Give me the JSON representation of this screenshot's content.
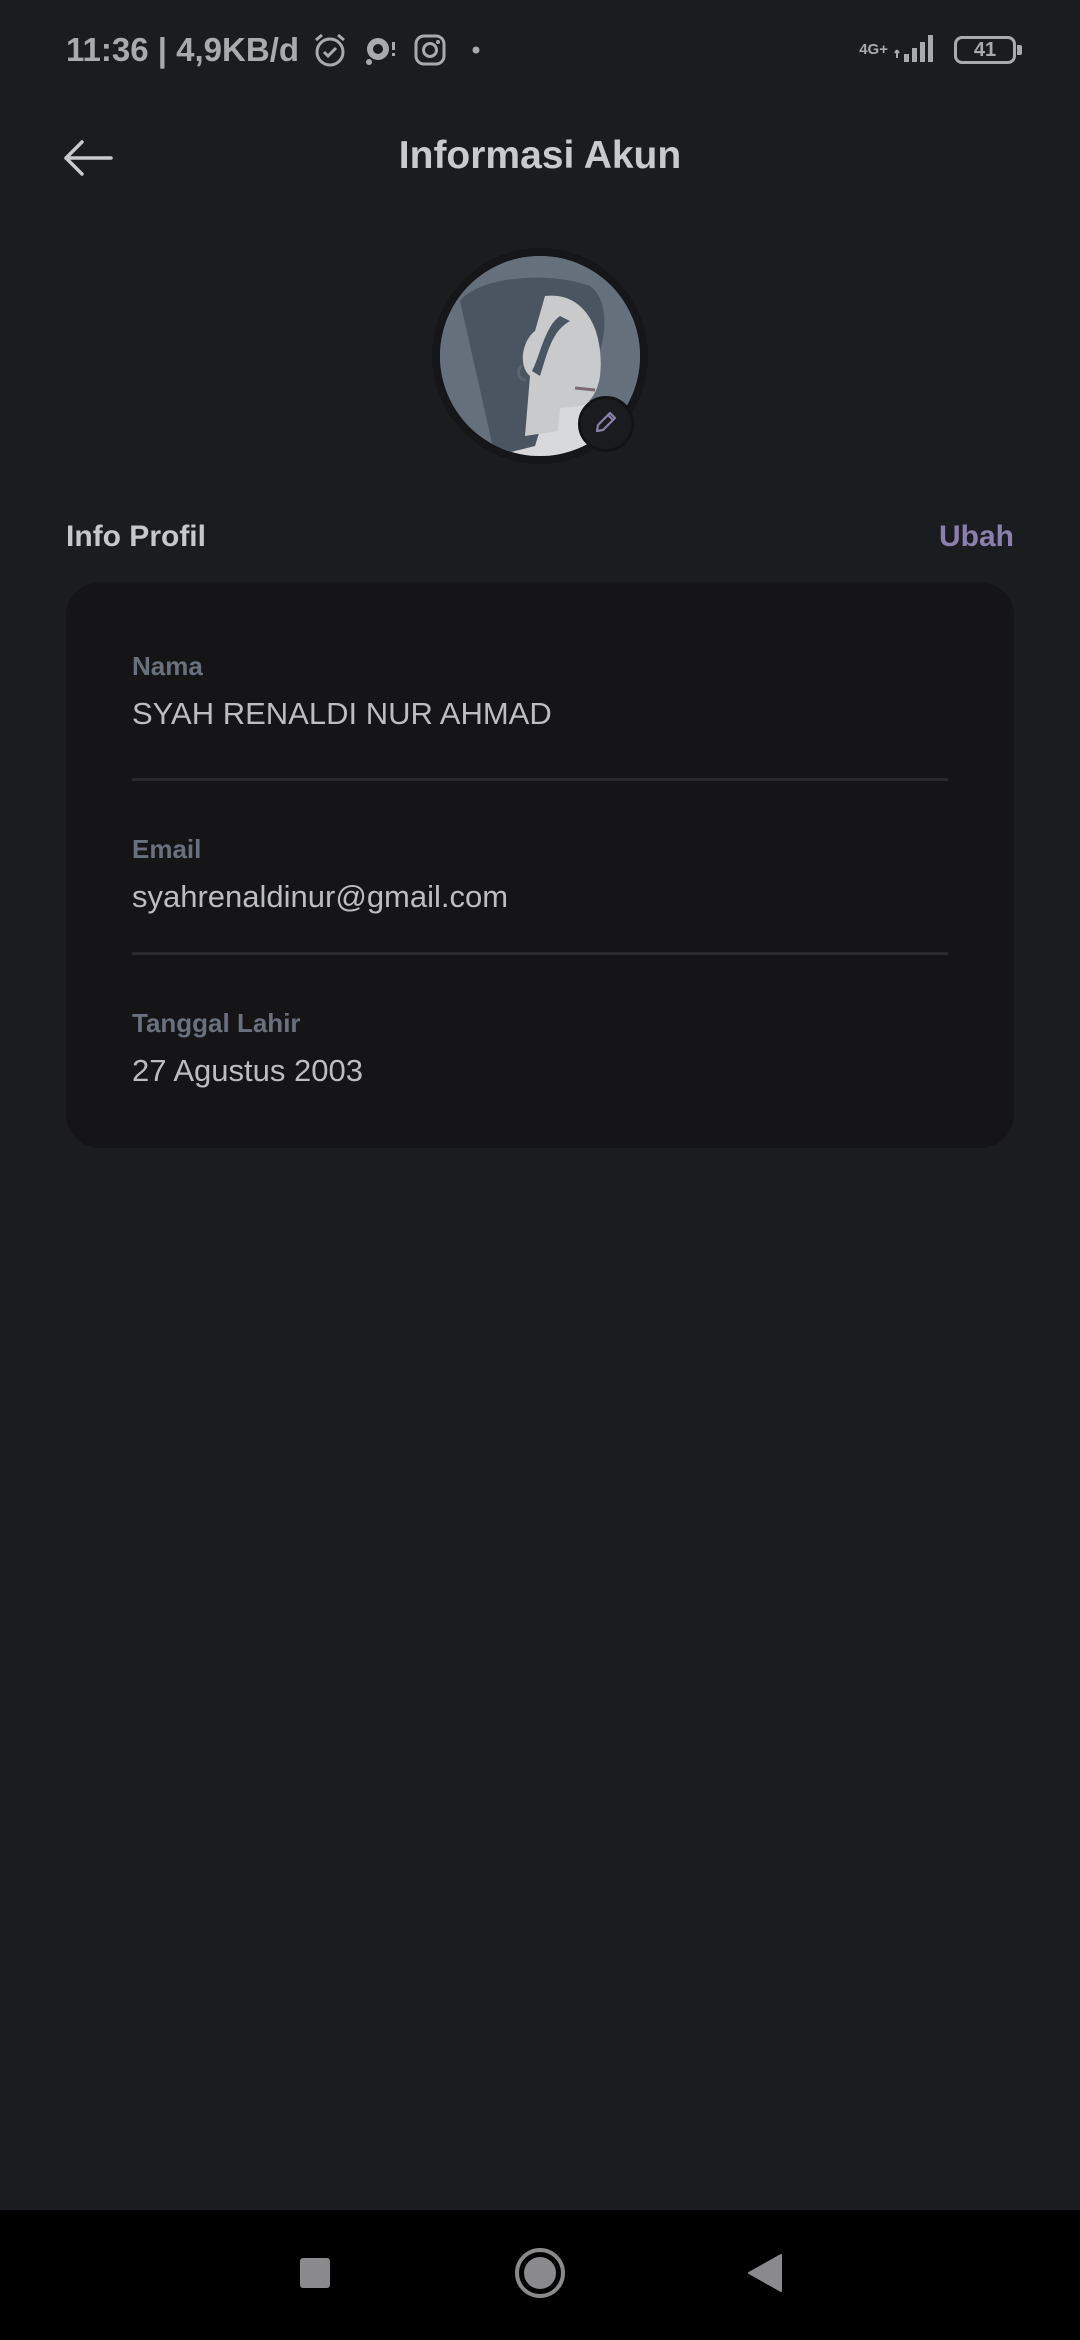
{
  "status_bar": {
    "time_speed": "11:36 | 4,9KB/d",
    "network": "4G+",
    "battery": "41",
    "icons": [
      "alarm-icon",
      "chat-bubble-icon",
      "instagram-icon",
      "dot-icon",
      "signal-icon",
      "battery-icon"
    ]
  },
  "header": {
    "title": "Informasi Akun",
    "back_icon": "arrow-left-icon"
  },
  "avatar": {
    "edit_icon": "pencil-icon"
  },
  "profile": {
    "section_title": "Info Profil",
    "edit_label": "Ubah",
    "fields": [
      {
        "label": "Nama",
        "value": "SYAH RENALDI NUR AHMAD"
      },
      {
        "label": "Email",
        "value": "syahrenaldinur@gmail.com"
      },
      {
        "label": "Tanggal Lahir",
        "value": "27 Agustus 2003"
      }
    ]
  },
  "nav_bar": {
    "icons": [
      "recents-square-icon",
      "home-circle-icon",
      "back-triangle-icon"
    ]
  },
  "colors": {
    "background": "#1b1c20",
    "card": "#151517",
    "accent": "#8b80ad",
    "label": "#6a717e",
    "nav_bar": "#000000"
  }
}
